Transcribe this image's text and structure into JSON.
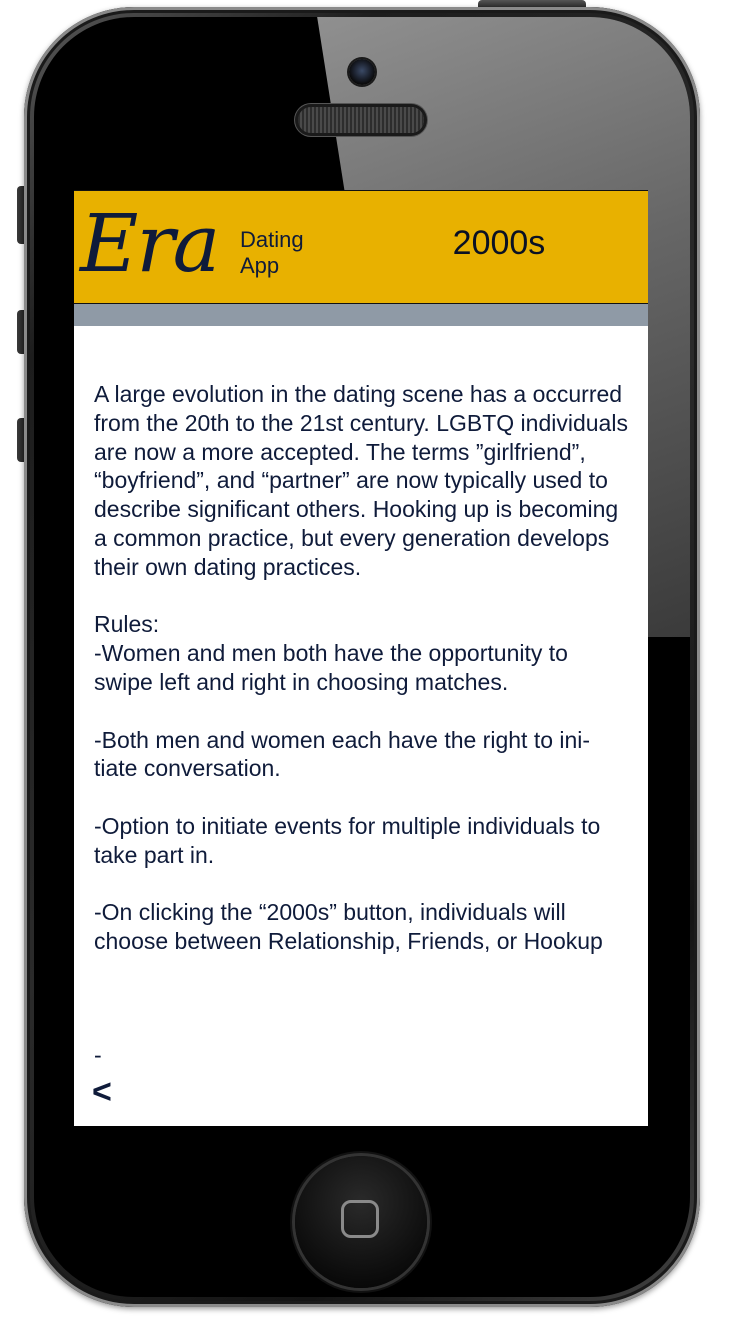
{
  "header": {
    "logo": "Era",
    "logo_sub_line1": "Dating",
    "logo_sub_line2": "App",
    "era_button_label": "2000s",
    "background_color": "#e8b100",
    "subbar_color": "#8f9aa6"
  },
  "content": {
    "intro": "A large evolution in the dating scene has a occurred from the 20th to the 21st century. LGBTQ individuals are now a more accepted. The terms ”girlfriend”, “boyfriend”, and “partner” are now typically used to describe significant others. Hooking up is becoming a common practice, but every generation develops their own dating practices.",
    "rules_heading": "Rules:",
    "rules": [
      "-Women and men both have the opportunity to swipe left and right in choosing matches.",
      "-Both men and women each have the right to ini-tiate conversation.",
      "-Option to initiate events for multiple individuals to take part in.",
      "-On clicking the “2000s” button, individuals will choose between Relationship, Friends, or Hookup"
    ],
    "trailing_dash": "-",
    "back_label": "<"
  },
  "icons": {
    "home": "home-square-icon",
    "camera": "camera-icon",
    "speaker": "speaker-grille-icon"
  },
  "colors": {
    "text": "#0f1b3a",
    "accent": "#e8b100"
  }
}
